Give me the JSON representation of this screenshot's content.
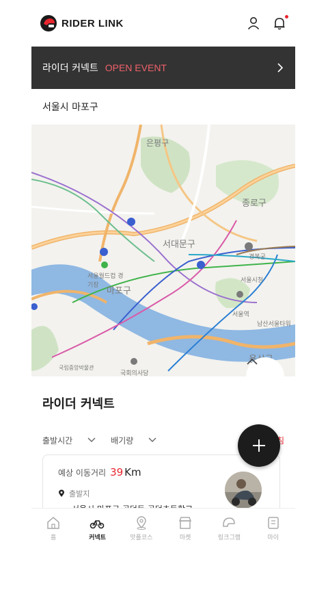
{
  "header": {
    "brand": "RIDER LINK",
    "icons": [
      "profile-icon",
      "bell-icon"
    ]
  },
  "banner": {
    "title": "라이더 커넥트",
    "event": "OPEN EVENT"
  },
  "region": "서울시 마포구",
  "map": {
    "labels": [
      "은평구",
      "종로구",
      "서대문구",
      "마포구",
      "용산구",
      "경복궁",
      "서울역",
      "서울시청",
      "남산서울타워",
      "서울월드컵 경기장",
      "국회의사당",
      "국립중앙박물관"
    ]
  },
  "section_title": "라이더 커넥트",
  "filters": {
    "departure": "출발시간",
    "displacement": "배기량",
    "refresh": "새로고침"
  },
  "card": {
    "distance_label": "예상 이동거리",
    "distance_value": "39",
    "distance_unit": "Km",
    "start_label": "출발지",
    "address": "서울시 마포구 공덕동 공덕초등학교"
  },
  "tabs": [
    {
      "label": "홈",
      "icon": "home-icon"
    },
    {
      "label": "커넥트",
      "icon": "connect-icon",
      "active": true
    },
    {
      "label": "맛플코스",
      "icon": "map-pin-icon"
    },
    {
      "label": "마켓",
      "icon": "market-icon"
    },
    {
      "label": "링크그램",
      "icon": "helmet-icon"
    },
    {
      "label": "마이",
      "icon": "my-icon"
    }
  ],
  "colors": {
    "accent": "#e8262f",
    "banner_bg": "#333333"
  }
}
